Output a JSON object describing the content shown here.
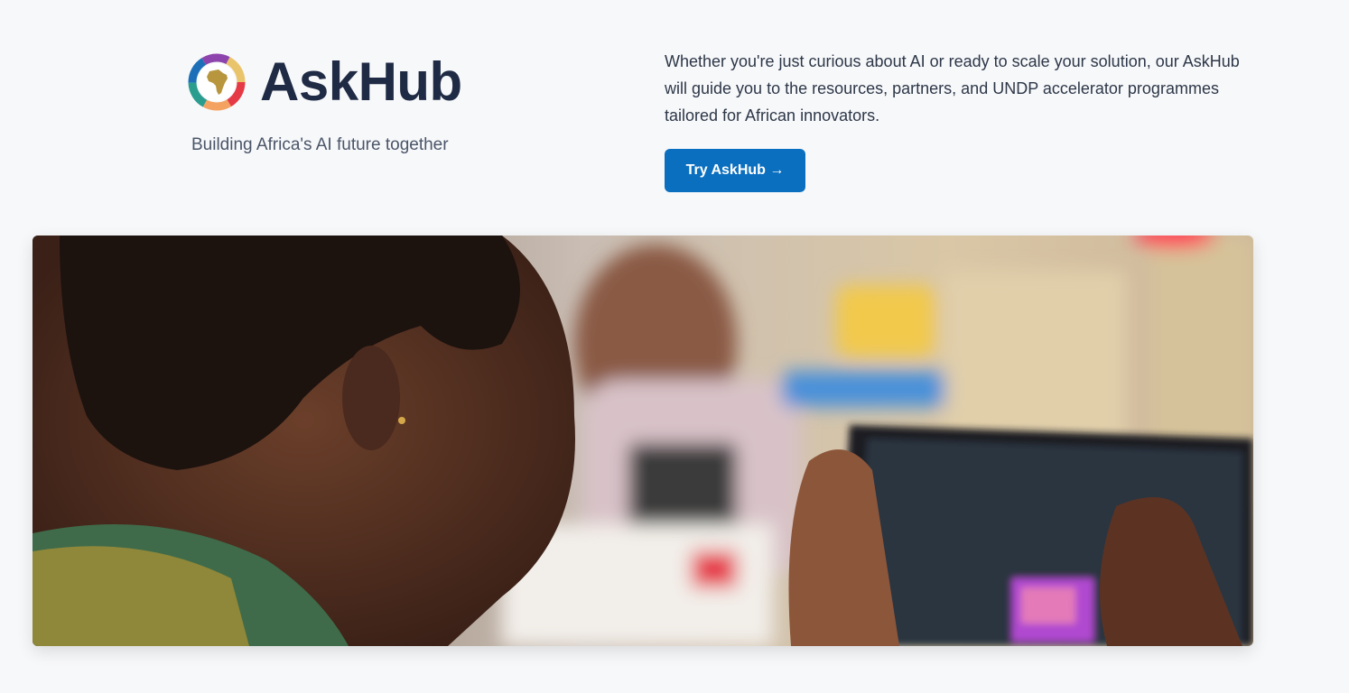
{
  "brand": {
    "name": "AskHub",
    "tagline": "Building Africa's AI future together"
  },
  "intro": {
    "text": "Whether you're just curious about AI or ready to scale your solution, our AskHub will guide you to the resources, partners, and UNDP accelerator programmes tailored for African innovators."
  },
  "cta": {
    "label": "Try AskHub →",
    "color": "#0a6fbf"
  },
  "colors": {
    "title": "#1f2a44",
    "background": "#f7f8fa"
  },
  "hero": {
    "subject": "photo of a young woman using a tablet"
  },
  "icons": {
    "logo": "africa-ring-logo-icon"
  }
}
